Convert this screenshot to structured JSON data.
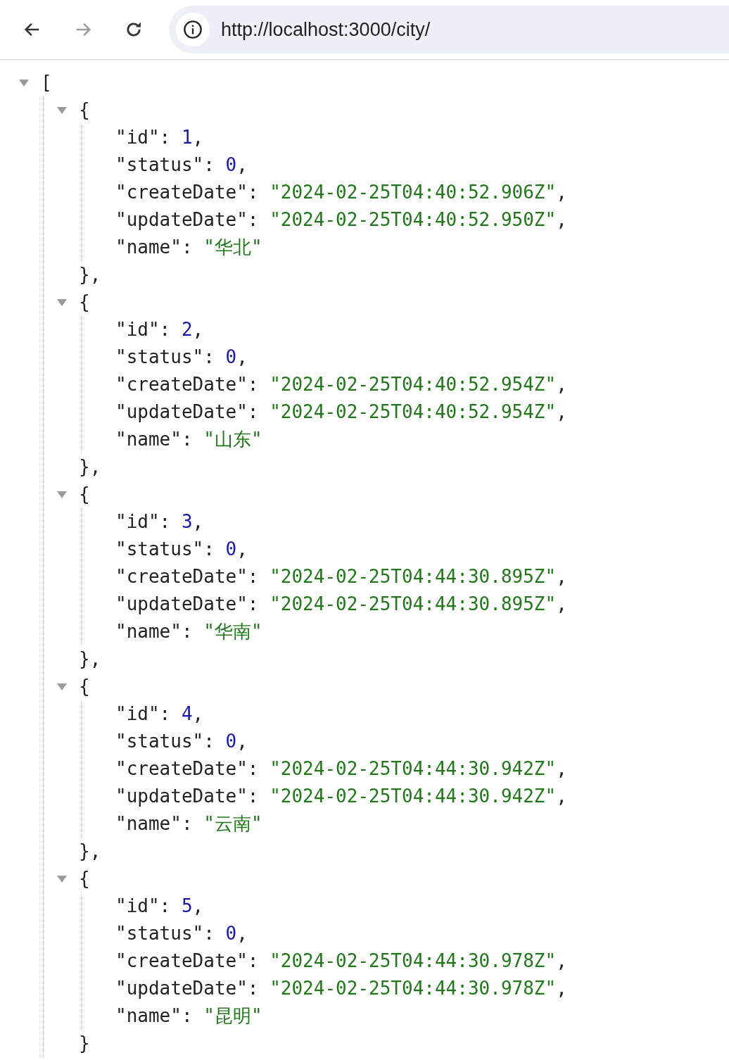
{
  "toolbar": {
    "buttons": [
      {
        "kind": "back",
        "disabled": false
      },
      {
        "kind": "forward",
        "disabled": true
      },
      {
        "kind": "reload",
        "disabled": false
      }
    ],
    "url": "http://localhost:3000/city/"
  },
  "viewer": {
    "open": "[",
    "expanded": true,
    "items": [
      {
        "open": "{",
        "close": "},",
        "expanded": true,
        "fields": [
          {
            "key": "\"id\": ",
            "value": "1",
            "end": ",",
            "kind": "number"
          },
          {
            "key": "\"status\": ",
            "value": "0",
            "end": ",",
            "kind": "number"
          },
          {
            "key": "\"createDate\": ",
            "value": "\"2024-02-25T04:40:52.906Z\"",
            "end": ",",
            "kind": "string"
          },
          {
            "key": "\"updateDate\": ",
            "value": "\"2024-02-25T04:40:52.950Z\"",
            "end": ",",
            "kind": "string"
          },
          {
            "key": "\"name\": ",
            "value": "\"华北\"",
            "kind": "string"
          }
        ]
      },
      {
        "open": "{",
        "close": "},",
        "expanded": true,
        "fields": [
          {
            "key": "\"id\": ",
            "value": "2",
            "end": ",",
            "kind": "number"
          },
          {
            "key": "\"status\": ",
            "value": "0",
            "end": ",",
            "kind": "number"
          },
          {
            "key": "\"createDate\": ",
            "value": "\"2024-02-25T04:40:52.954Z\"",
            "end": ",",
            "kind": "string"
          },
          {
            "key": "\"updateDate\": ",
            "value": "\"2024-02-25T04:40:52.954Z\"",
            "end": ",",
            "kind": "string"
          },
          {
            "key": "\"name\": ",
            "value": "\"山东\"",
            "kind": "string"
          }
        ]
      },
      {
        "open": "{",
        "close": "},",
        "expanded": true,
        "fields": [
          {
            "key": "\"id\": ",
            "value": "3",
            "end": ",",
            "kind": "number"
          },
          {
            "key": "\"status\": ",
            "value": "0",
            "end": ",",
            "kind": "number"
          },
          {
            "key": "\"createDate\": ",
            "value": "\"2024-02-25T04:44:30.895Z\"",
            "end": ",",
            "kind": "string"
          },
          {
            "key": "\"updateDate\": ",
            "value": "\"2024-02-25T04:44:30.895Z\"",
            "end": ",",
            "kind": "string"
          },
          {
            "key": "\"name\": ",
            "value": "\"华南\"",
            "kind": "string"
          }
        ]
      },
      {
        "open": "{",
        "close": "},",
        "expanded": true,
        "fields": [
          {
            "key": "\"id\": ",
            "value": "4",
            "end": ",",
            "kind": "number"
          },
          {
            "key": "\"status\": ",
            "value": "0",
            "end": ",",
            "kind": "number"
          },
          {
            "key": "\"createDate\": ",
            "value": "\"2024-02-25T04:44:30.942Z\"",
            "end": ",",
            "kind": "string"
          },
          {
            "key": "\"updateDate\": ",
            "value": "\"2024-02-25T04:44:30.942Z\"",
            "end": ",",
            "kind": "string"
          },
          {
            "key": "\"name\": ",
            "value": "\"云南\"",
            "kind": "string"
          }
        ]
      },
      {
        "open": "{",
        "close": "}",
        "expanded": true,
        "fields": [
          {
            "key": "\"id\": ",
            "value": "5",
            "end": ",",
            "kind": "number"
          },
          {
            "key": "\"status\": ",
            "value": "0",
            "end": ",",
            "kind": "number"
          },
          {
            "key": "\"createDate\": ",
            "value": "\"2024-02-25T04:44:30.978Z\"",
            "end": ",",
            "kind": "string"
          },
          {
            "key": "\"updateDate\": ",
            "value": "\"2024-02-25T04:44:30.978Z\"",
            "end": ",",
            "kind": "string"
          },
          {
            "key": "\"name\": ",
            "value": "\"昆明\"",
            "kind": "string"
          }
        ]
      }
    ]
  }
}
